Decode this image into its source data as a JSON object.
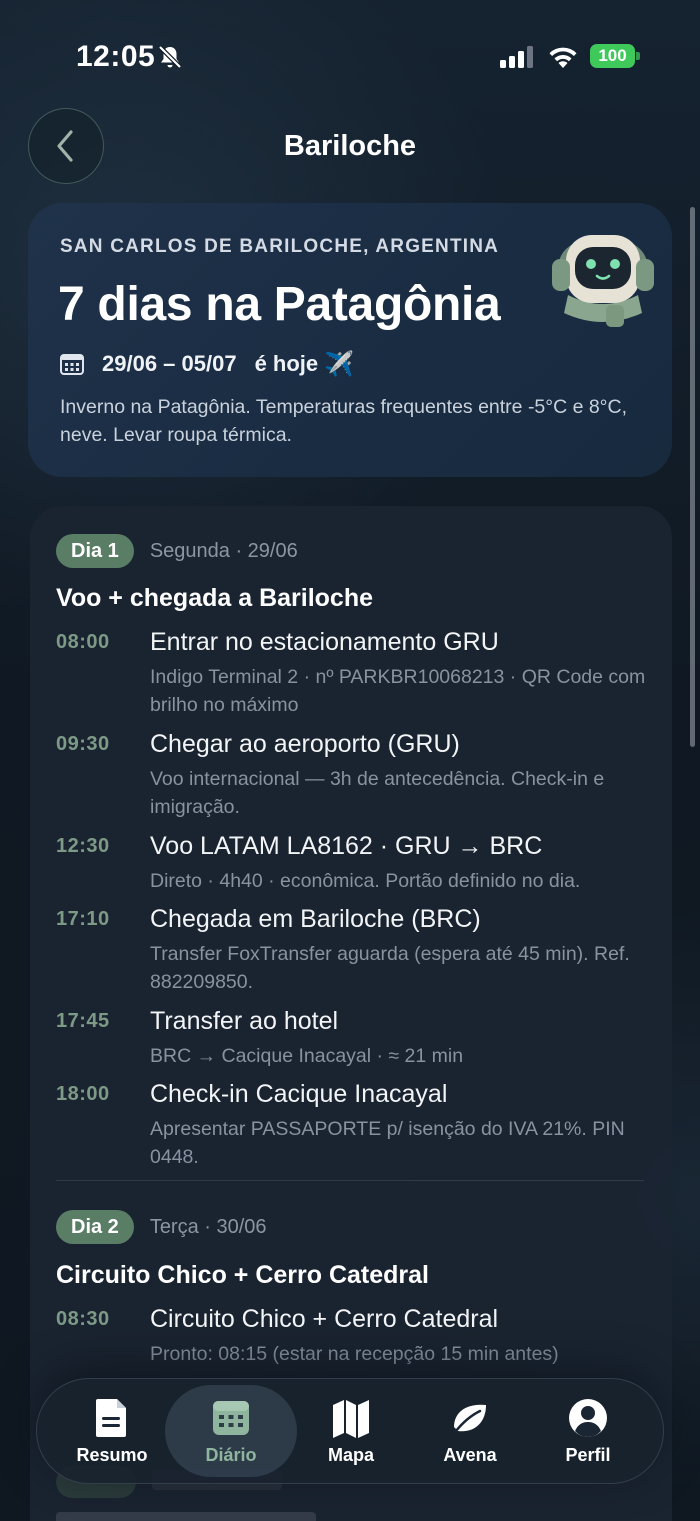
{
  "status_bar": {
    "time": "12:05",
    "battery": "100",
    "icons": [
      "bell-slash-icon",
      "signal-icon",
      "wifi-icon",
      "battery-icon"
    ]
  },
  "header": {
    "title": "Bariloche",
    "back_icon": "chevron-left-icon"
  },
  "trip": {
    "location": "SAN CARLOS DE BARILOCHE, ARGENTINA",
    "name": "7 dias na Patagônia",
    "dates": "29/06 – 05/07",
    "today_label": "é hoje",
    "today_emoji": "✈️",
    "note": "Inverno na Patagônia. Temperaturas frequentes entre -5°C e 8°C, neve. Levar roupa térmica."
  },
  "days": [
    {
      "badge": "Dia 1",
      "date": "Segunda · 29/06",
      "title": "Voo + chegada a Bariloche",
      "events": [
        {
          "time": "08:00",
          "title": "Entrar no estacionamento GRU",
          "desc": "Indigo Terminal 2 · nº PARKBR10068213 · QR Code com brilho no máximo"
        },
        {
          "time": "09:30",
          "title": "Chegar ao aeroporto (GRU)",
          "desc": "Voo internacional — 3h de antecedência. Check-in e imigração."
        },
        {
          "time": "12:30",
          "title": "Voo LATAM LA8162 · GRU → BRC",
          "desc": "Direto · 4h40 · econômica. Portão definido no dia."
        },
        {
          "time": "17:10",
          "title": "Chegada em Bariloche (BRC)",
          "desc": "Transfer FoxTransfer aguarda (espera até 45 min). Ref. 882209850."
        },
        {
          "time": "17:45",
          "title": "Transfer ao hotel",
          "desc": "BRC → Cacique Inacayal · ≈ 21 min"
        },
        {
          "time": "18:00",
          "title": "Check-in Cacique Inacayal",
          "desc": "Apresentar PASSAPORTE p/ isenção do IVA 21%. PIN 0448."
        }
      ]
    },
    {
      "badge": "Dia 2",
      "date": "Terça · 30/06",
      "title": "Circuito Chico + Cerro Catedral",
      "events": [
        {
          "time": "08:30",
          "title": "Circuito Chico + Cerro Catedral",
          "desc": "Pronto: 08:15 (estar na recepção 15 min antes)"
        }
      ]
    }
  ],
  "tabs": [
    {
      "label": "Resumo",
      "icon": "document-icon",
      "active": false
    },
    {
      "label": "Diário",
      "icon": "calendar-icon",
      "active": true
    },
    {
      "label": "Mapa",
      "icon": "map-icon",
      "active": false
    },
    {
      "label": "Avena",
      "icon": "leaf-icon",
      "active": false
    },
    {
      "label": "Perfil",
      "icon": "profile-icon",
      "active": false
    }
  ]
}
